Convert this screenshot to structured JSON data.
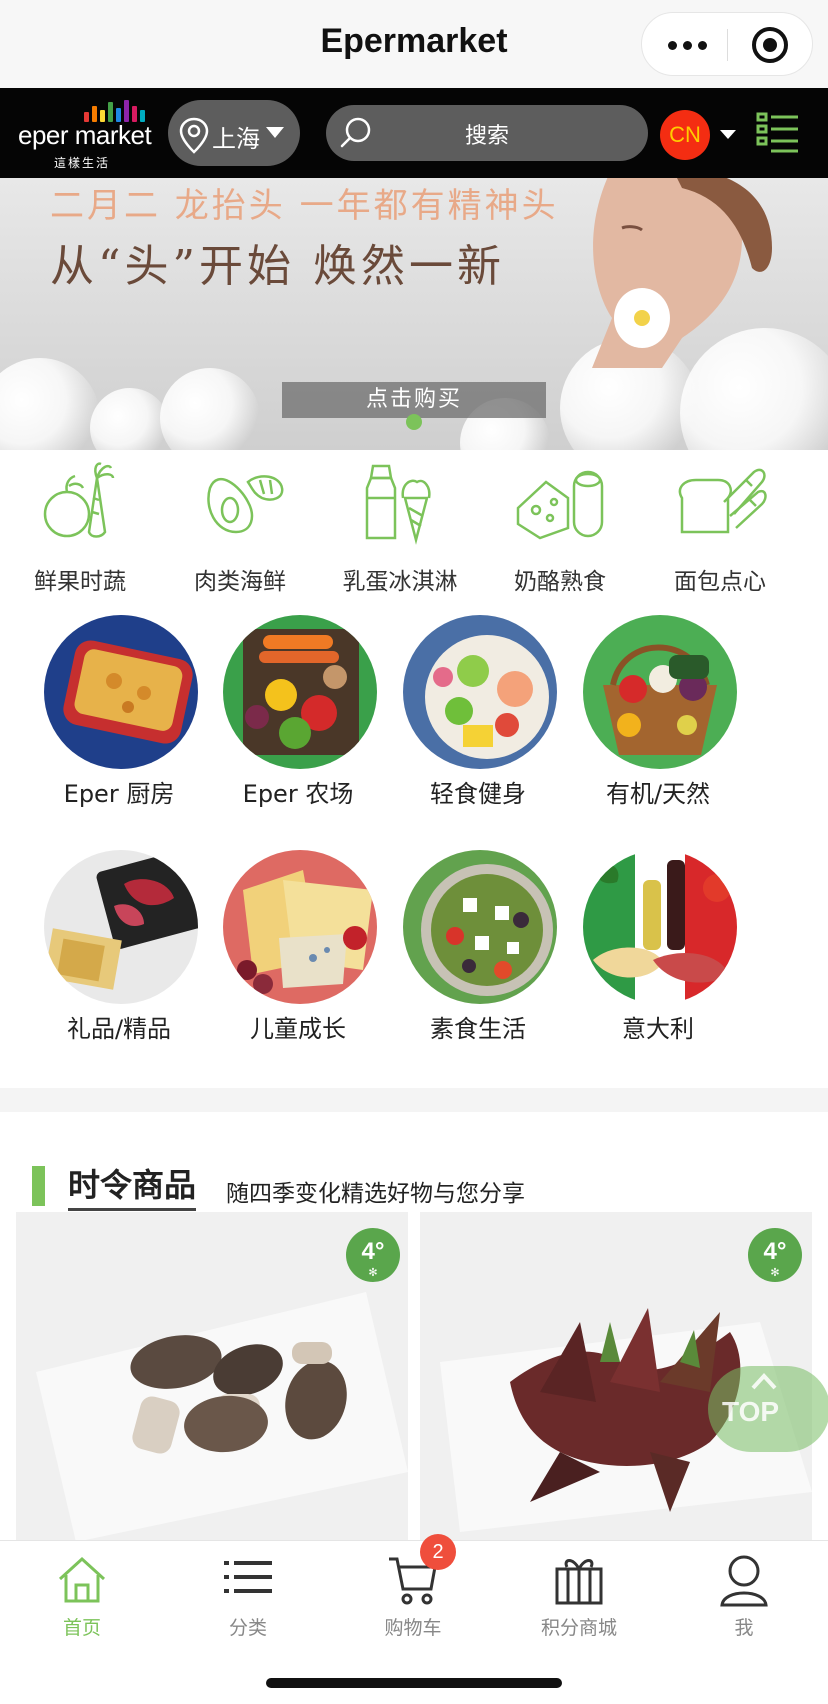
{
  "app": {
    "title": "Epermarket"
  },
  "header": {
    "logo_text": "eper market",
    "logo_sub": "這樣生活",
    "location": "上海",
    "search_placeholder": "搜索",
    "lang": "CN",
    "logo_bar_colors": [
      "#e53935",
      "#f57c00",
      "#fdd835",
      "#43a047",
      "#1e88e5",
      "#8e24aa",
      "#d81b60",
      "#00acc1"
    ]
  },
  "banner": {
    "line1": "二月二 龙抬头 一年都有精神头",
    "line2": "从“头”开始 焕然一新",
    "button": "点击购买"
  },
  "categories": [
    {
      "label": "鲜果时蔬",
      "icon": "fruit-vegetable-icon"
    },
    {
      "label": "肉类海鲜",
      "icon": "meat-seafood-icon"
    },
    {
      "label": "乳蛋冰淇淋",
      "icon": "dairy-icecream-icon"
    },
    {
      "label": "奶酪熟食",
      "icon": "cheese-deli-icon"
    },
    {
      "label": "面包点心",
      "icon": "bread-icon"
    }
  ],
  "tiles": [
    {
      "label": "Eper 厨房"
    },
    {
      "label": "Eper 农场"
    },
    {
      "label": "轻食健身"
    },
    {
      "label": "有机/天然"
    },
    {
      "label": "礼品/精品"
    },
    {
      "label": "儿童成长"
    },
    {
      "label": "素食生活"
    },
    {
      "label": "意大利"
    }
  ],
  "section": {
    "title": "时令商品",
    "subtitle": "随四季变化精选好物与您分享"
  },
  "products": [
    {
      "badge": "4°"
    },
    {
      "badge": "4°"
    }
  ],
  "top_button": "TOP",
  "tabbar": {
    "items": [
      {
        "label": "首页",
        "icon": "home-icon",
        "active": true
      },
      {
        "label": "分类",
        "icon": "list-icon",
        "active": false
      },
      {
        "label": "购物车",
        "icon": "cart-icon",
        "active": false
      },
      {
        "label": "积分商城",
        "icon": "gift-icon",
        "active": false
      },
      {
        "label": "我",
        "icon": "user-icon",
        "active": false
      }
    ],
    "cart_count": "2"
  },
  "colors": {
    "accent": "#7cc35a",
    "header_bg": "#050505",
    "badge_red": "#ef4e3c",
    "lang_bg": "#f42d12"
  }
}
